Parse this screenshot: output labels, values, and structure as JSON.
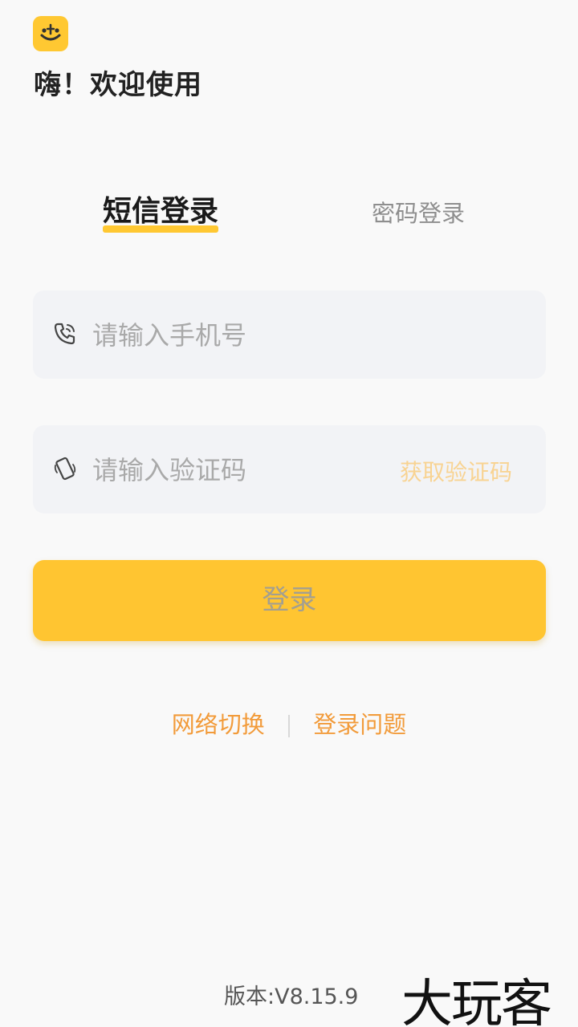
{
  "header": {
    "logo_icon": "smiley-logo-icon",
    "welcome_text": "嗨！欢迎使用"
  },
  "tabs": [
    {
      "label": "短信登录",
      "active": true
    },
    {
      "label": "密码登录",
      "active": false
    }
  ],
  "phone_field": {
    "icon": "phone-icon",
    "placeholder": "请输入手机号",
    "value": ""
  },
  "code_field": {
    "icon": "mobile-device-icon",
    "placeholder": "请输入验证码",
    "value": "",
    "get_code_label": "获取验证码"
  },
  "login_button": {
    "label": "登录"
  },
  "links": {
    "network_switch": "网络切换",
    "login_issue": "登录问题"
  },
  "footer": {
    "version": "版本:V8.15.9"
  },
  "watermark": "大玩客",
  "colors": {
    "accent": "#ffc531",
    "link": "#f29b3a",
    "background": "#f9f9f9",
    "field_bg": "#f2f3f6"
  }
}
